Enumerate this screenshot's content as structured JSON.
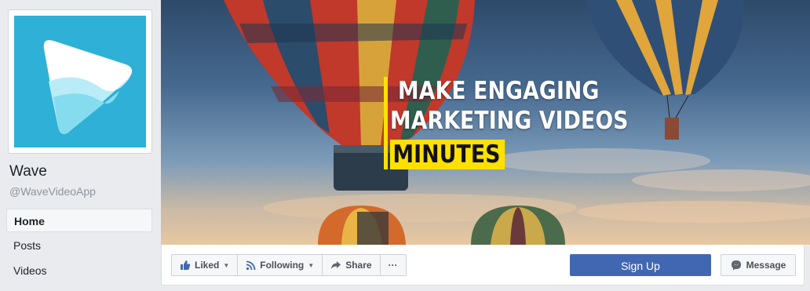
{
  "page": {
    "name": "Wave",
    "handle": "@WaveVideoApp"
  },
  "nav": {
    "items": [
      "Home",
      "Posts",
      "Videos"
    ],
    "active": "Home"
  },
  "cover": {
    "headline_1": "MAKE ENGAGING",
    "headline_2": "MARKETING VIDEOS",
    "headline_3": "MINUTES",
    "accent": "#ffe000"
  },
  "actions": {
    "liked": "Liked",
    "following": "Following",
    "share": "Share",
    "more": "···",
    "signup": "Sign Up",
    "message": "Message"
  },
  "colors": {
    "brand": "#2fb0d6",
    "primary_button": "#4267b2"
  },
  "icons": {
    "liked": "thumbs-up-icon",
    "following": "rss-icon",
    "share": "share-arrow-icon",
    "message": "messenger-icon"
  }
}
